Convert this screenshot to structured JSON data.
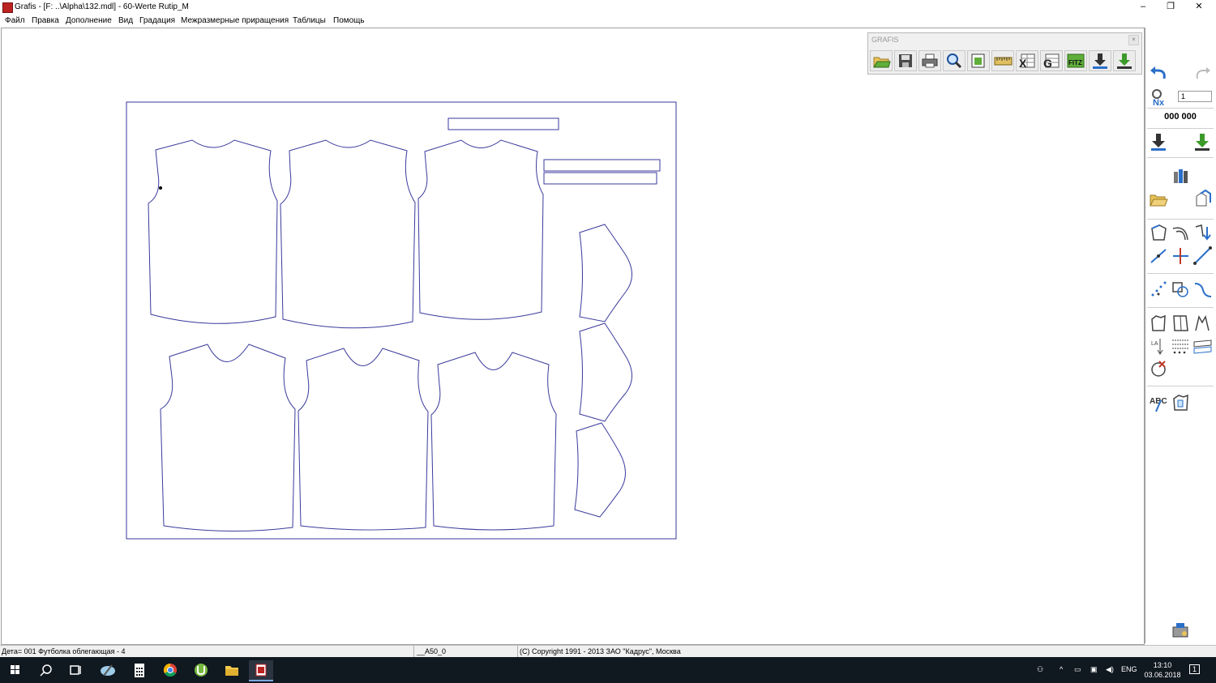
{
  "window": {
    "title": "Grafis - [F: ..\\Alpha\\132.mdl] - 60-Werte Rutip_M",
    "minimize_glyph": "–",
    "maximize_glyph": "❐",
    "close_glyph": "✕"
  },
  "menu": {
    "items": [
      "Файл",
      "Правка",
      "Дополнение",
      "Вид",
      "Градация",
      "Межразмерные приращения",
      "Таблицы",
      "Помощь"
    ]
  },
  "toolpanel": {
    "title": "GRAFIS",
    "close_glyph": "×",
    "buttons": [
      {
        "icon": "open-folder-icon"
      },
      {
        "icon": "save-icon"
      },
      {
        "icon": "print-icon"
      },
      {
        "icon": "magnifier-icon"
      },
      {
        "icon": "page-icon"
      },
      {
        "icon": "ruler-icon"
      },
      {
        "icon": "excel-table-icon"
      },
      {
        "icon": "g-table-icon"
      },
      {
        "icon": "fitz-icon"
      },
      {
        "icon": "download-icon"
      },
      {
        "icon": "download-green-icon"
      }
    ]
  },
  "rightbar": {
    "page_field": "1",
    "counter": "000 000"
  },
  "status": {
    "part": "Дета= 001  Футболка облегающая - 4",
    "size": "__A50_0",
    "copyright": "(C) Copyright 1991 - 2013 ЗАО \"Кадрус\", Москва"
  },
  "taskbar": {
    "lang": "ENG",
    "time": "13:10",
    "date": "03.06.2018",
    "notify_count": "1"
  },
  "colors": {
    "pattern_line": "#3a3a9c",
    "taskbar_bg": "#101820",
    "accent_blue": "#2a6fc9",
    "accent_green": "#3c9a2a"
  }
}
